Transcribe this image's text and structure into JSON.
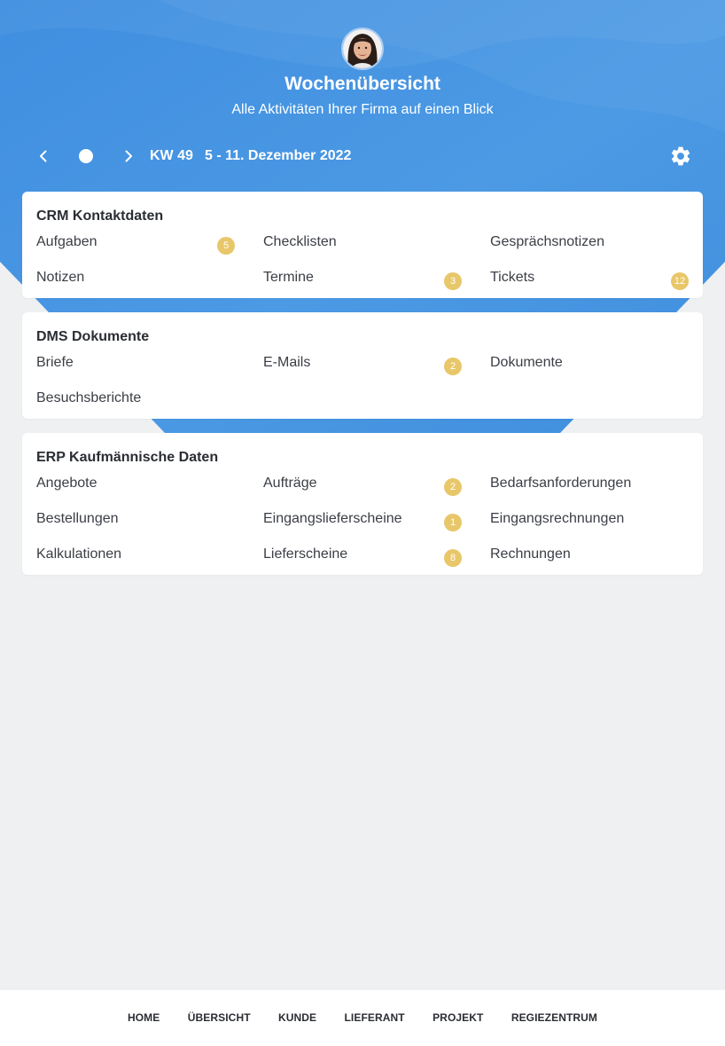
{
  "header": {
    "title": "Wochenübersicht",
    "subtitle": "Alle Aktivitäten Ihrer Firma auf einen Blick"
  },
  "week_nav": {
    "week": "KW 49",
    "range": "5 - 11. Dezember 2022"
  },
  "sections": [
    {
      "title": "CRM Kontaktdaten",
      "items": [
        {
          "label": "Aufgaben",
          "badge": "5"
        },
        {
          "label": "Checklisten",
          "badge": ""
        },
        {
          "label": "Gesprächsnotizen",
          "badge": ""
        },
        {
          "label": "Notizen",
          "badge": ""
        },
        {
          "label": "Termine",
          "badge": "3"
        },
        {
          "label": "Tickets",
          "badge": "12"
        }
      ]
    },
    {
      "title": "DMS Dokumente",
      "items": [
        {
          "label": "Briefe",
          "badge": ""
        },
        {
          "label": "E-Mails",
          "badge": "2"
        },
        {
          "label": "Dokumente",
          "badge": ""
        },
        {
          "label": "Besuchsberichte",
          "badge": ""
        }
      ]
    },
    {
      "title": "ERP Kaufmännische Daten",
      "items": [
        {
          "label": "Angebote",
          "badge": ""
        },
        {
          "label": "Aufträge",
          "badge": "2"
        },
        {
          "label": "Bedarfsanforderungen",
          "badge": ""
        },
        {
          "label": "Bestellungen",
          "badge": ""
        },
        {
          "label": "Eingangslieferscheine",
          "badge": "1"
        },
        {
          "label": "Eingangsrechnungen",
          "badge": ""
        },
        {
          "label": "Kalkulationen",
          "badge": ""
        },
        {
          "label": "Lieferscheine",
          "badge": "8"
        },
        {
          "label": "Rechnungen",
          "badge": ""
        }
      ]
    }
  ],
  "footer": {
    "nav": [
      "HOME",
      "ÜBERSICHT",
      "KUNDE",
      "LIEFERANT",
      "PROJEKT",
      "REGIEZENTRUM"
    ]
  },
  "colors": {
    "accent": "#4a97e0",
    "badge": "#e8c76a",
    "background": "#eff0f2"
  },
  "icons": {
    "prev": "chevron-left-icon",
    "today": "today-dot-icon",
    "next": "chevron-right-icon",
    "settings": "gear-icon"
  }
}
